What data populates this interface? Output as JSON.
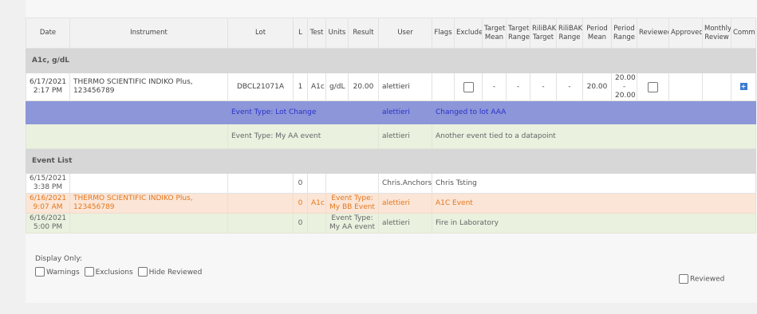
{
  "columns": [
    "Date",
    "Instrument",
    "Lot",
    "L",
    "Test",
    "Units",
    "Result",
    "User",
    "Flags",
    "Excluded",
    "Target Mean",
    "Target Range",
    "RiliBAK Target",
    "RiliBAK Range",
    "Period Mean",
    "Period Range",
    "Reviewed",
    "Approved",
    "Monthly Review",
    "Comment"
  ],
  "group1": "A1c, g/dL",
  "row1": {
    "date": "6/17/2021",
    "time": "2:17 PM",
    "instrument": "THERMO SCIENTIFIC INDIKO Plus, 123456789",
    "lot": "DBCL21071A",
    "level": "1",
    "test": "A1c",
    "units": "g/dL",
    "result": "20.00",
    "user": "alettieri",
    "target_mean": "-",
    "target_range": "-",
    "rilibak_target": "-",
    "rilibak_range": "-",
    "period_mean": "20.00",
    "period_range": [
      "20.00",
      "-",
      "20.00"
    ]
  },
  "event_blue": {
    "type": "Event Type: Lot Change",
    "user": "alettieri",
    "desc": "Changed to lot AAA"
  },
  "event_green": {
    "type": "Event Type: My AA event",
    "user": "alettieri",
    "desc": "Another event tied to a datapoint"
  },
  "group2": "Event List",
  "list1": {
    "date": "6/15/2021",
    "time": "3:38 PM",
    "level": "0",
    "user": "Chris.Anchors",
    "desc": "Chris Tsting"
  },
  "list2": {
    "date": "6/16/2021",
    "time": "9:07 AM",
    "instrument": "THERMO SCIENTIFIC INDIKO Plus, 123456789",
    "level": "0",
    "test": "A1c",
    "event": "Event Type: My BB Event",
    "user": "alettieri",
    "desc": "A1C Event"
  },
  "list3": {
    "date": "6/16/2021",
    "time": "5:00 PM",
    "level": "0",
    "event": "Event Type: My AA event",
    "user": "alettieri",
    "desc": "Fire in Laboratory"
  },
  "footer": {
    "display_only": "Display Only:",
    "warnings": "Warnings",
    "exclusions": "Exclusions",
    "hide_reviewed": "Hide Reviewed",
    "reviewed": "Reviewed"
  },
  "colors": {
    "blue_row": "#8c96d8",
    "blue_text": "#2a33c9",
    "green_row": "#eaf1df",
    "orange_row": "#fbe5d6",
    "orange_text": "#e3781e",
    "group_row": "#d7d7d7"
  }
}
